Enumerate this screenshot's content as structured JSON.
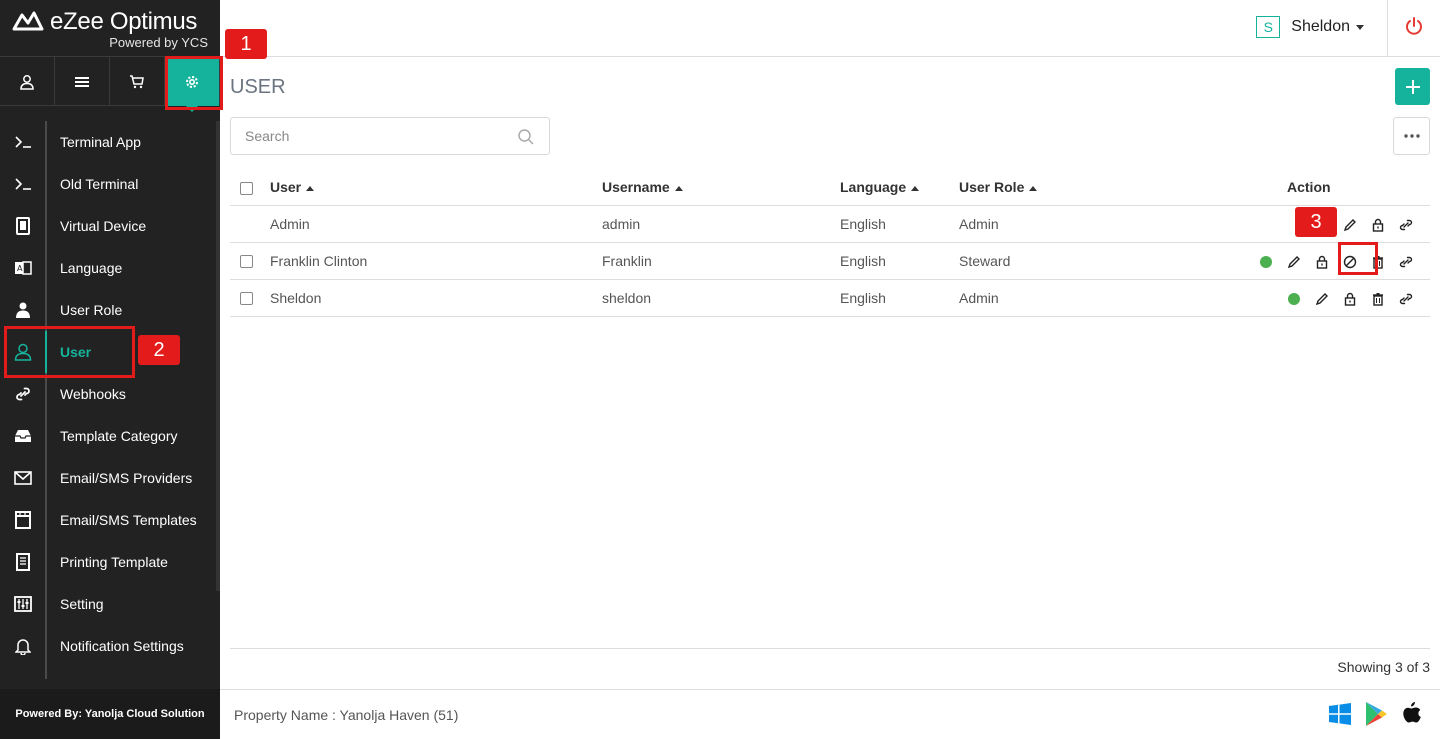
{
  "brand": {
    "title": "eZee Optimus",
    "subtitle": "Powered by YCS"
  },
  "top_nav": [
    {
      "icon": "user-icon"
    },
    {
      "icon": "list-icon"
    },
    {
      "icon": "cart-icon"
    },
    {
      "icon": "gear-icon",
      "active": true
    }
  ],
  "menu": [
    {
      "label": "Terminal App",
      "icon": "terminal-icon"
    },
    {
      "label": "Old Terminal",
      "icon": "terminal-icon"
    },
    {
      "label": "Virtual Device",
      "icon": "device-icon"
    },
    {
      "label": "Language",
      "icon": "language-icon"
    },
    {
      "label": "User Role",
      "icon": "person-icon"
    },
    {
      "label": "User",
      "icon": "user-outline-icon",
      "active": true
    },
    {
      "label": "Webhooks",
      "icon": "link-icon"
    },
    {
      "label": "Template Category",
      "icon": "inbox-icon"
    },
    {
      "label": "Email/SMS Providers",
      "icon": "envelope-icon"
    },
    {
      "label": "Email/SMS Templates",
      "icon": "template-icon"
    },
    {
      "label": "Printing Template",
      "icon": "receipt-icon"
    },
    {
      "label": "Setting",
      "icon": "sliders-icon"
    },
    {
      "label": "Notification Settings",
      "icon": "bell-icon"
    }
  ],
  "sidebar_footer": "Powered By: Yanolja Cloud Solution",
  "header": {
    "user_initial": "S",
    "user_name": "Sheldon"
  },
  "page": {
    "title": "USER",
    "search_placeholder": "Search"
  },
  "table": {
    "columns": {
      "user": "User",
      "username": "Username",
      "language": "Language",
      "user_role": "User Role",
      "action": "Action"
    },
    "rows": [
      {
        "user": "Admin",
        "username": "admin",
        "language": "English",
        "user_role": "Admin"
      },
      {
        "user": "Franklin Clinton",
        "username": "Franklin",
        "language": "English",
        "user_role": "Steward"
      },
      {
        "user": "Sheldon",
        "username": "sheldon",
        "language": "English",
        "user_role": "Admin"
      }
    ]
  },
  "showing": "Showing 3 of 3",
  "footer": {
    "property": "Property Name : Yanolja Haven (51)"
  },
  "markers": {
    "m1": "1",
    "m2": "2",
    "m3": "3"
  },
  "colors": {
    "accent": "#16b39c",
    "sidebar": "#222222",
    "status_active": "#4caf50",
    "annotation": "#e31b1b",
    "power": "#e53935"
  }
}
